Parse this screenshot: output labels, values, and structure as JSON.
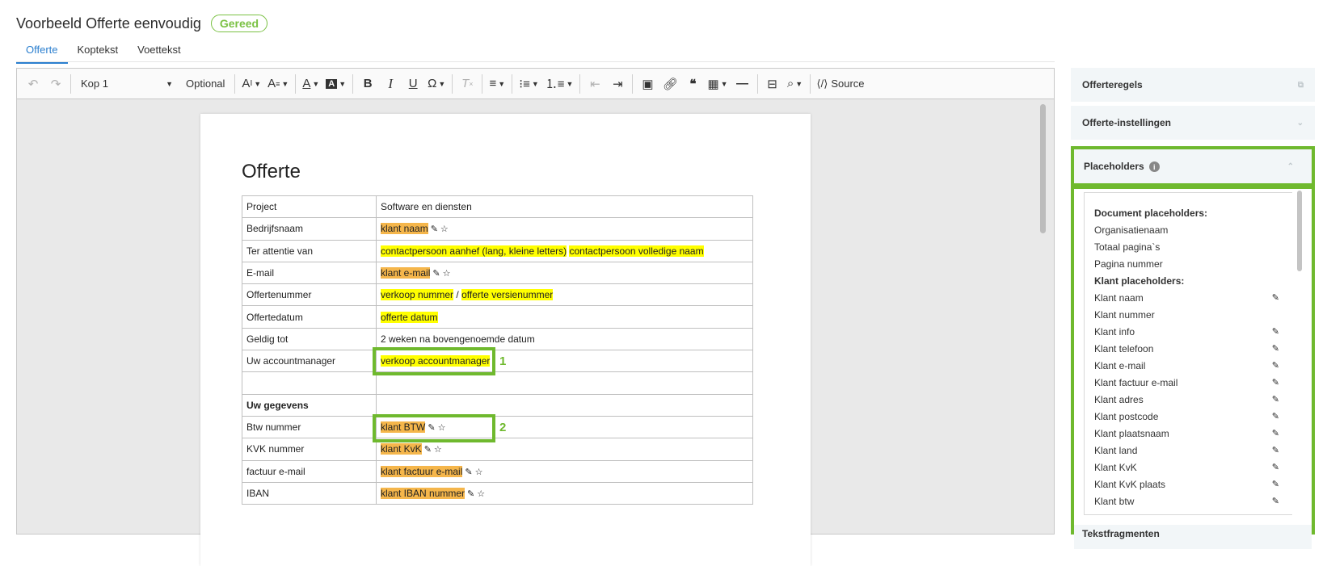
{
  "header": {
    "title": "Voorbeeld Offerte eenvoudig",
    "status": "Gereed"
  },
  "tabs": [
    {
      "label": "Offerte"
    },
    {
      "label": "Koptekst"
    },
    {
      "label": "Voettekst"
    }
  ],
  "toolbar": {
    "heading": "Kop 1",
    "optional": "Optional",
    "source": "Source"
  },
  "document": {
    "title": "Offerte",
    "rows": [
      {
        "label": "Project",
        "value": "Software en diensten"
      },
      {
        "label": "Bedrijfsnaam",
        "placeholder": "klant naam"
      },
      {
        "label": "Ter attentie van",
        "placeholder": "contactpersoon aanhef (lang, kleine letters)",
        "placeholder2": "contactpersoon volledige naam"
      },
      {
        "label": "E-mail",
        "placeholder": "klant e-mail"
      },
      {
        "label": "Offertenummer",
        "placeholder": "verkoop nummer",
        "sep": "/",
        "placeholder2": "offerte versienummer"
      },
      {
        "label": "Offertedatum",
        "placeholder": "offerte datum"
      },
      {
        "label": "Geldig tot",
        "value": "2 weken na bovengenoemde datum"
      },
      {
        "label": "Uw accountmanager",
        "placeholder": "verkoop accountmanager"
      },
      {
        "label": "",
        "value": ""
      },
      {
        "label": "Uw gegevens",
        "value": ""
      },
      {
        "label": "Btw nummer",
        "placeholder": "klant BTW"
      },
      {
        "label": "KVK nummer",
        "placeholder": "klant KvK"
      },
      {
        "label": "factuur e-mail",
        "placeholder": "klant factuur e-mail"
      },
      {
        "label": "IBAN",
        "placeholder": "klant IBAN nummer"
      }
    ],
    "callouts": [
      "1",
      "2"
    ]
  },
  "sidebar": {
    "offerteregels": "Offerteregels",
    "instellingen": "Offerte-instellingen",
    "placeholders": "Placeholders",
    "tekstfragmenten": "Tekstfragmenten",
    "doc_header": "Document placeholders:",
    "doc_items": [
      "Organisatienaam",
      "Totaal pagina`s",
      "Pagina nummer"
    ],
    "klant_header": "Klant placeholders:",
    "klant_items": [
      "Klant naam",
      "Klant nummer",
      "Klant info",
      "Klant telefoon",
      "Klant e-mail",
      "Klant factuur e-mail",
      "Klant adres",
      "Klant postcode",
      "Klant plaatsnaam",
      "Klant land",
      "Klant KvK",
      "Klant KvK plaats",
      "Klant btw"
    ]
  },
  "colors": {
    "accent": "#2b7fcf",
    "highlight_green": "#6fb92e",
    "placeholder_yellow": "#ffff00",
    "placeholder_orange": "#f5b64b"
  }
}
